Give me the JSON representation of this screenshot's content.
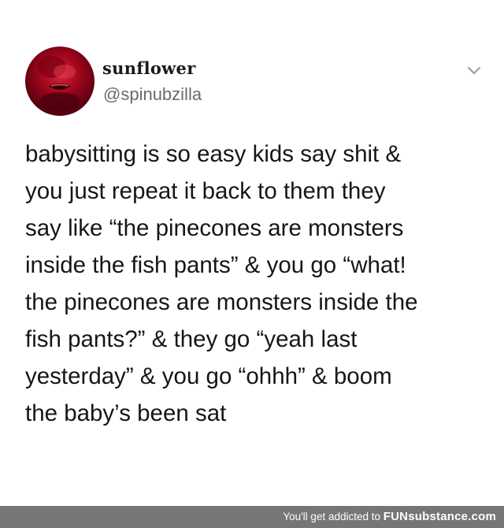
{
  "tweet": {
    "author": {
      "display_name": "sunflower",
      "handle": "@spinubzilla",
      "avatar_icon": "profile-photo-red"
    },
    "menu_icon": "chevron-down-icon",
    "text_lines": [
      "babysitting is so easy kids say shit &",
      "you just repeat it back to them they",
      "say like “the pinecones are monsters",
      "inside the fish pants” & you go “what!",
      "the pinecones are monsters inside the",
      "fish pants?” & they go “yeah last",
      "yesterday” & you go “ohhh” & boom",
      "the baby’s been sat"
    ]
  },
  "footer": {
    "tagline": "You'll get addicted to",
    "brand": "FUNsubstance.com",
    "background_color": "#767676"
  },
  "colors": {
    "text": "#161616",
    "handle": "#6b6b6b",
    "avatar_red": "#a3061c"
  }
}
